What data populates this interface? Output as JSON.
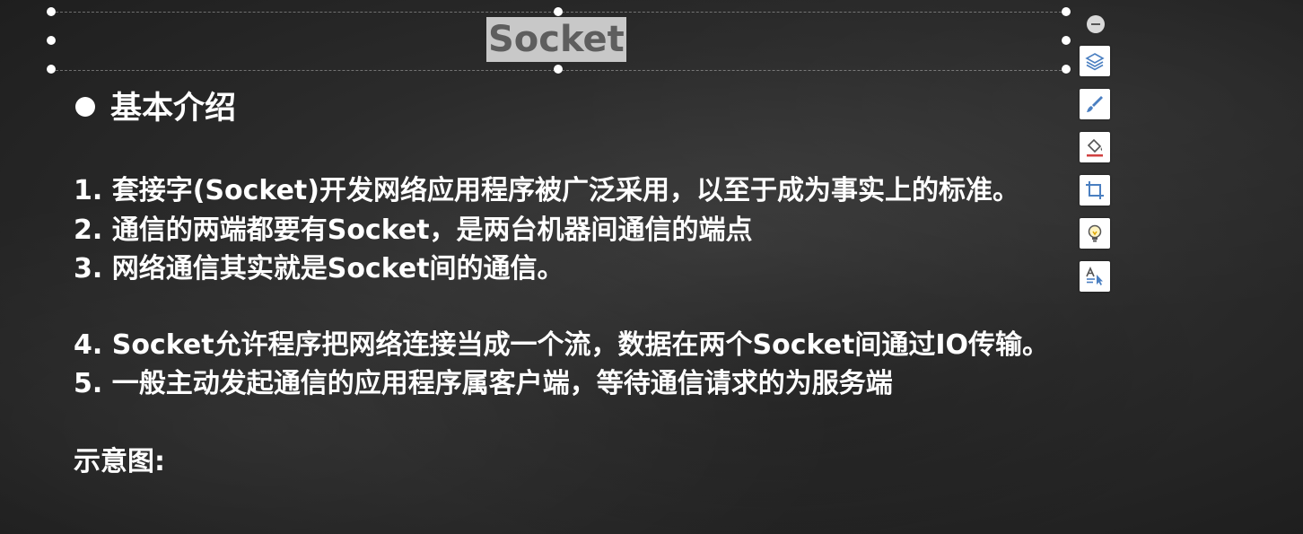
{
  "slide": {
    "title": "Socket",
    "heading": "基本介绍",
    "lines": [
      "1. 套接字(Socket)开发网络应用程序被广泛采用，以至于成为事实上的标准。",
      "2. 通信的两端都要有Socket，是两台机器间通信的端点",
      "3. 网络通信其实就是Socket间的通信。",
      "4. Socket允许程序把网络连接当成一个流，数据在两个Socket间通过IO传输。",
      "5. 一般主动发起通信的应用程序属客户端，等待通信请求的为服务端",
      "示意图:"
    ]
  },
  "toolbar": {
    "buttons": [
      {
        "icon": "layers-icon"
      },
      {
        "icon": "brush-icon"
      },
      {
        "icon": "fill-bucket-icon"
      },
      {
        "icon": "crop-icon"
      },
      {
        "icon": "lightbulb-icon"
      },
      {
        "icon": "text-cursor-icon"
      }
    ]
  },
  "colors": {
    "board": "#2b2b2b",
    "text": "#ffffff",
    "title_highlight": "#c8c8c8",
    "title_text": "#5e5e5e",
    "fill_accent": "#d04040",
    "bulb_accent": "#e0a800",
    "icon_blue": "#4a7fc1"
  }
}
